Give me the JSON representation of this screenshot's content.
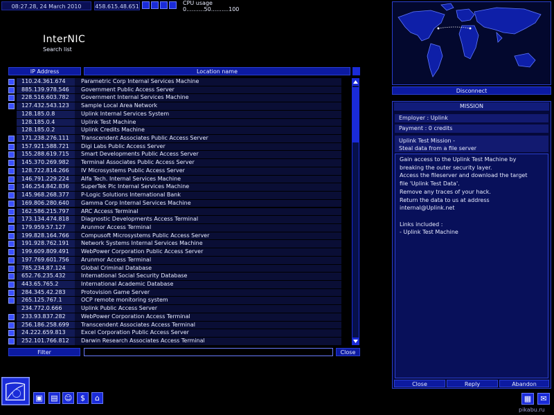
{
  "topbar": {
    "datetime": "08:27.28, 24 March 2010",
    "gateway_ip": "458.615.48.651",
    "speed_icons": [
      "pause-icon",
      "play-icon",
      "fast-forward-icon",
      "fastest-icon"
    ],
    "cpu_label": "CPU usage",
    "cpu_scale": "0..........50..........100"
  },
  "page": {
    "title": "InterNIC",
    "subtitle": "Search list"
  },
  "table": {
    "col_ip": "IP Address",
    "col_location": "Location name",
    "rows": [
      {
        "ip": "110.24.361.674",
        "location": "Parametric Corp Internal Services Machine",
        "expand": true
      },
      {
        "ip": "885.139.978.546",
        "location": "Government Public Access Server",
        "expand": true
      },
      {
        "ip": "228.516.603.782",
        "location": "Government Internal Services Machine",
        "expand": true
      },
      {
        "ip": "127.432.543.123",
        "location": "Sample Local Area Network",
        "expand": true
      },
      {
        "ip": "128.185.0.8",
        "location": "Uplink Internal Services System",
        "expand": false
      },
      {
        "ip": "128.185.0.4",
        "location": "Uplink Test Machine",
        "expand": false
      },
      {
        "ip": "128.185.0.2",
        "location": "Uplink Credits Machine",
        "expand": false
      },
      {
        "ip": "171.238.276.111",
        "location": "Transcendent Associates Public Access Server",
        "expand": true
      },
      {
        "ip": "157.921.588.721",
        "location": "Digi Labs Public Access Server",
        "expand": true
      },
      {
        "ip": "155.288.619.715",
        "location": "Smart Developments Public Access Server",
        "expand": true
      },
      {
        "ip": "145.370.269.982",
        "location": "Terminal Associates Public Access Server",
        "expand": true
      },
      {
        "ip": "128.722.814.266",
        "location": "IV Microsystems Public Access Server",
        "expand": true
      },
      {
        "ip": "146.791.229.224",
        "location": "Alfa Tech. Internal Services Machine",
        "expand": true
      },
      {
        "ip": "146.254.842.836",
        "location": "SuperTek Plc Internal Services Machine",
        "expand": true
      },
      {
        "ip": "145.968.268.377",
        "location": "P-Logic Solutions International Bank",
        "expand": true
      },
      {
        "ip": "169.806.280.640",
        "location": "Gamma Corp Internal Services Machine",
        "expand": true
      },
      {
        "ip": "162.586.215.797",
        "location": "ARC Access Terminal",
        "expand": true
      },
      {
        "ip": "173.134.474.818",
        "location": "Diagnostic Developments Access Terminal",
        "expand": true
      },
      {
        "ip": "179.959.57.127",
        "location": "Arunmor Access Terminal",
        "expand": true
      },
      {
        "ip": "199.828.164.766",
        "location": "Compusoft Microsystems Public Access Server",
        "expand": true
      },
      {
        "ip": "191.928.762.191",
        "location": "Network Systems Internal Services Machine",
        "expand": true
      },
      {
        "ip": "199.609.809.491",
        "location": "WebPower Corporation Public Access Server",
        "expand": true
      },
      {
        "ip": "197.769.601.756",
        "location": "Arunmor Access Terminal",
        "expand": true
      },
      {
        "ip": "785.234.87.124",
        "location": "Global Criminal Database",
        "expand": true
      },
      {
        "ip": "652.76.235.432",
        "location": "International Social Security Database",
        "expand": true
      },
      {
        "ip": "443.65.765.2",
        "location": "International Academic Database",
        "expand": true
      },
      {
        "ip": "284.345.42.283",
        "location": "Protovision Game Server",
        "expand": true
      },
      {
        "ip": "265.125.767.1",
        "location": "OCP remote monitoring system",
        "expand": true
      },
      {
        "ip": "234.772.0.666",
        "location": "Uplink Public Access Server",
        "expand": false
      },
      {
        "ip": "233.93.837.282",
        "location": "WebPower Corporation Access Terminal",
        "expand": true
      },
      {
        "ip": "256.186.258.699",
        "location": "Transcendent Associates Access Terminal",
        "expand": true
      },
      {
        "ip": "24.222.659.813",
        "location": "Excel Corporation Public Access Server",
        "expand": true
      },
      {
        "ip": "252.101.766.812",
        "location": "Darwin Research Associates Access Terminal",
        "expand": true
      }
    ]
  },
  "filter": {
    "button": "Filter",
    "value": "",
    "close": "Close"
  },
  "map": {
    "disconnect": "Disconnect"
  },
  "mission": {
    "title": "MISSION",
    "employer": "Employer : Uplink",
    "payment": "Payment : 0 credits",
    "desc_line1": "Uplink Test Mission -",
    "desc_line2": "Steal data from a file server",
    "body": "Gain access to the Uplink Test Machine by\nbreaking the outer security layer.\nAccess the fileserver and download the target\nfile 'Uplink Test Data'.\nRemove any traces of your hack.\nReturn the data to us at address\ninternal@Uplink.net\n\nLinks included :\n- Uplink Test Machine",
    "close": "Close",
    "reply": "Reply",
    "abandon": "Abandon"
  },
  "dock": {
    "left_icons": [
      "save-icon",
      "disk-icon",
      "person-icon",
      "finance-icon",
      "hardware-icon"
    ],
    "right_icons": [
      "notes-icon",
      "email-icon"
    ]
  },
  "watermark": "pikabu.ru"
}
